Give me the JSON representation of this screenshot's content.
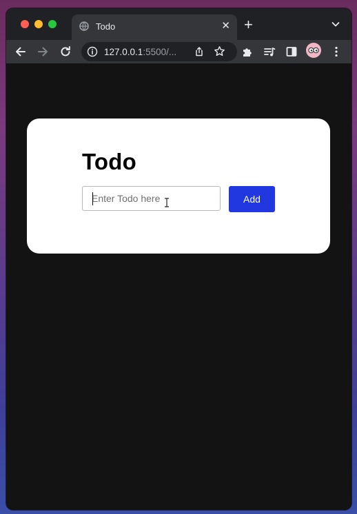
{
  "browser": {
    "tab": {
      "title": "Todo",
      "close_glyph": "✕"
    },
    "new_tab_glyph": "+",
    "address": {
      "host": "127.0.0.1",
      "rest": ":5500/..."
    }
  },
  "app": {
    "heading": "Todo",
    "input": {
      "placeholder": "Enter Todo here",
      "value": ""
    },
    "add_label": "Add"
  },
  "colors": {
    "accent": "#2137e0",
    "page_background": "#131313",
    "card_background": "#ffffff"
  },
  "icons": {
    "back": "arrow-left-icon",
    "forward": "arrow-right-icon",
    "reload": "reload-icon",
    "info": "info-icon",
    "share": "share-icon",
    "bookmark": "star-icon",
    "extensions": "puzzle-icon",
    "media": "media-queue-icon",
    "side_panel": "side-panel-icon",
    "profile": "avatar",
    "menu": "kebab-menu-icon"
  }
}
